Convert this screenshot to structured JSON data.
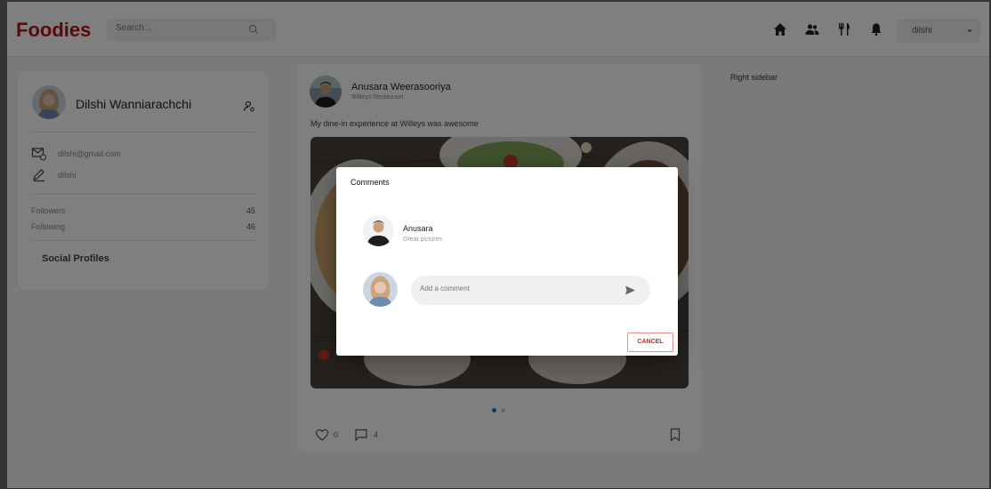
{
  "header": {
    "logo": "Foodies",
    "search_placeholder": "Search...",
    "nav_icons": [
      "home-icon",
      "people-icon",
      "restaurant-icon",
      "bell-icon"
    ],
    "user_select_value": "dilshi"
  },
  "profile": {
    "name": "Dilshi Wanniarachchi",
    "email": "dilshi@gmail.com",
    "username": "dilshi",
    "stats": [
      {
        "label": "Followers",
        "value": "45"
      },
      {
        "label": "Following",
        "value": "46"
      }
    ],
    "social_title": "Social Profiles"
  },
  "post": {
    "author": "Anusara Weerasooriya",
    "subtitle": "Willeys Restaurant",
    "text": "My dine-in experience at Willeys was awesome",
    "likes": "0",
    "comments": "4"
  },
  "right_sidebar": "Right sidebar",
  "dialog": {
    "title": "Comments",
    "comment": {
      "author": "Anusara",
      "text": "Great pictures"
    },
    "input_placeholder": "Add a comment",
    "cancel_label": "CANCEL"
  },
  "colors": {
    "brand": "#b51414",
    "accent": "#1976d2",
    "cancel": "#c62828"
  }
}
